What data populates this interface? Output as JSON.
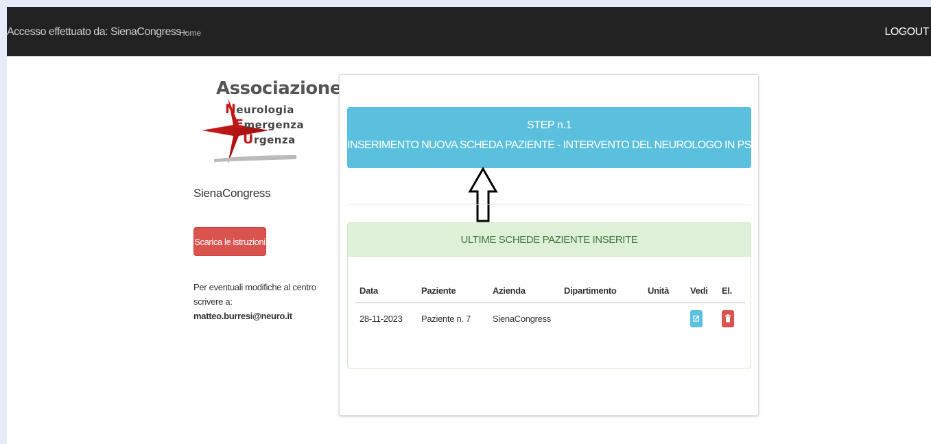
{
  "navbar": {
    "brand": "Accesso effettuato da: SienaCongress -",
    "home": "Home",
    "logout": "LOGOUT"
  },
  "logo": {
    "title": "Associazione",
    "lines": [
      {
        "cap": "N",
        "rest": "eurologia"
      },
      {
        "cap": "E",
        "rest": "mergenza"
      },
      {
        "cap": "U",
        "rest": "rgenza"
      }
    ]
  },
  "sidebar": {
    "username": "SienaCongress",
    "instructions_button": "Scarica le istruzioni",
    "note_text": "Per eventuali modifiche al centro scrivere a: ",
    "note_email": "matteo.burresi@neuro.it"
  },
  "step": {
    "line1": "STEP n.1",
    "line2": "INSERIMENTO NUOVA SCHEDA PAZIENTE - INTERVENTO DEL NEUROLOGO IN PS"
  },
  "recent": {
    "title": "ULTIME SCHEDE PAZIENTE INSERITE",
    "columns": [
      "Data",
      "Paziente",
      "Azienda",
      "Dipartimento",
      "Unità",
      "Vedi",
      "El."
    ],
    "rows": [
      {
        "data": "28-11-2023",
        "paziente": "Paziente n. 7",
        "azienda": "SienaCongress",
        "dipartimento": "",
        "unita": ""
      }
    ]
  },
  "colors": {
    "navbar": "#222222",
    "info": "#5bc0de",
    "danger": "#d9534f",
    "success_bg": "#dff0d8",
    "success_text": "#3c763d"
  },
  "icons": [
    "edit-icon",
    "trash-icon",
    "up-arrow-icon"
  ]
}
